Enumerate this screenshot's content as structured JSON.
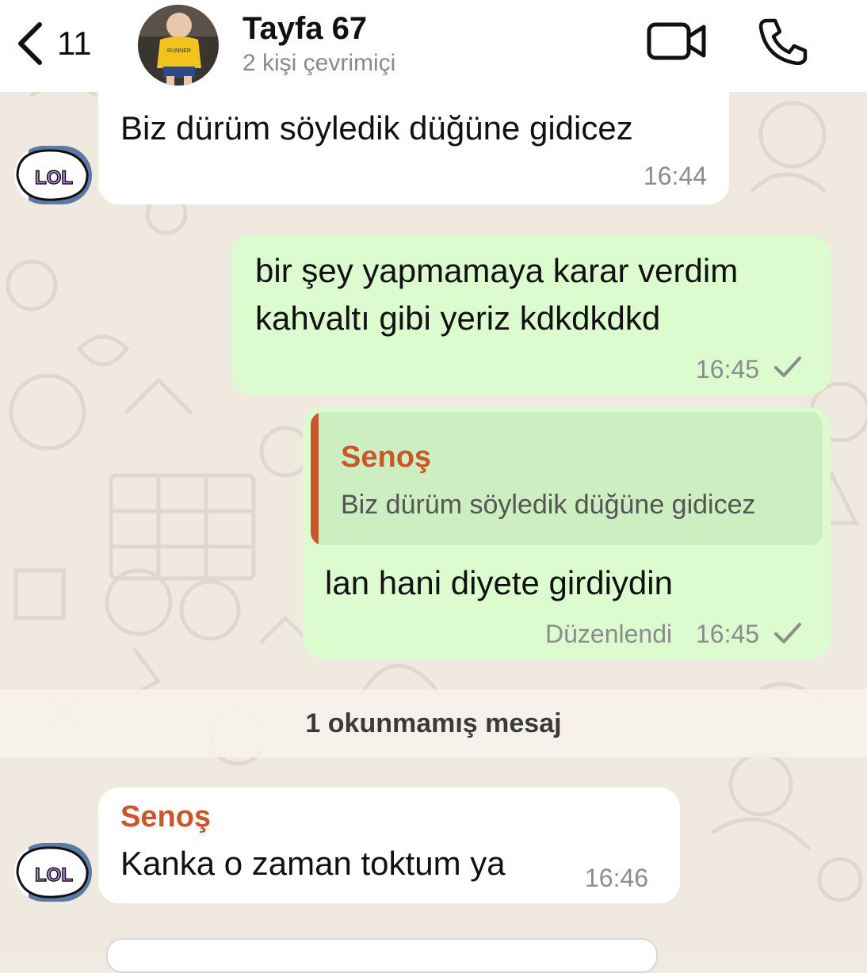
{
  "header": {
    "back_count": "11",
    "title": "Tayfa 67",
    "subtitle": "2 kişi çevrimiçi",
    "avatar_shirt_text": "RUNNER"
  },
  "messages": [
    {
      "direction": "incoming",
      "text": "Biz dürüm söyledik düğüne gidicez",
      "time": "16:44",
      "sticker_text": "LOL"
    },
    {
      "direction": "outgoing",
      "text_line1": "bir şey yapmamaya karar verdim",
      "text_line2": "kahvaltı gibi yeriz kdkdkdkd",
      "time": "16:45",
      "status": "sent"
    },
    {
      "direction": "outgoing",
      "quote_sender": "Senoş",
      "quote_text": "Biz dürüm söyledik düğüne gidicez",
      "text": "lan hani diyete girdiydin",
      "edited_label": "Düzenlendi",
      "time": "16:45",
      "status": "sent"
    },
    {
      "direction": "incoming",
      "sender": "Senoş",
      "text": "Kanka o zaman toktum ya",
      "time": "16:46",
      "sticker_text": "LOL"
    }
  ],
  "unread_divider": "1 okunmamış mesaj",
  "colors": {
    "incoming_bubble": "#ffffff",
    "outgoing_bubble": "#dcfcd0",
    "sender_name": "#c9562d",
    "chat_background": "#efe9e0"
  },
  "icons": [
    "chevron-left-icon",
    "video-camera-icon",
    "phone-icon",
    "check-icon",
    "lol-sticker-icon"
  ]
}
